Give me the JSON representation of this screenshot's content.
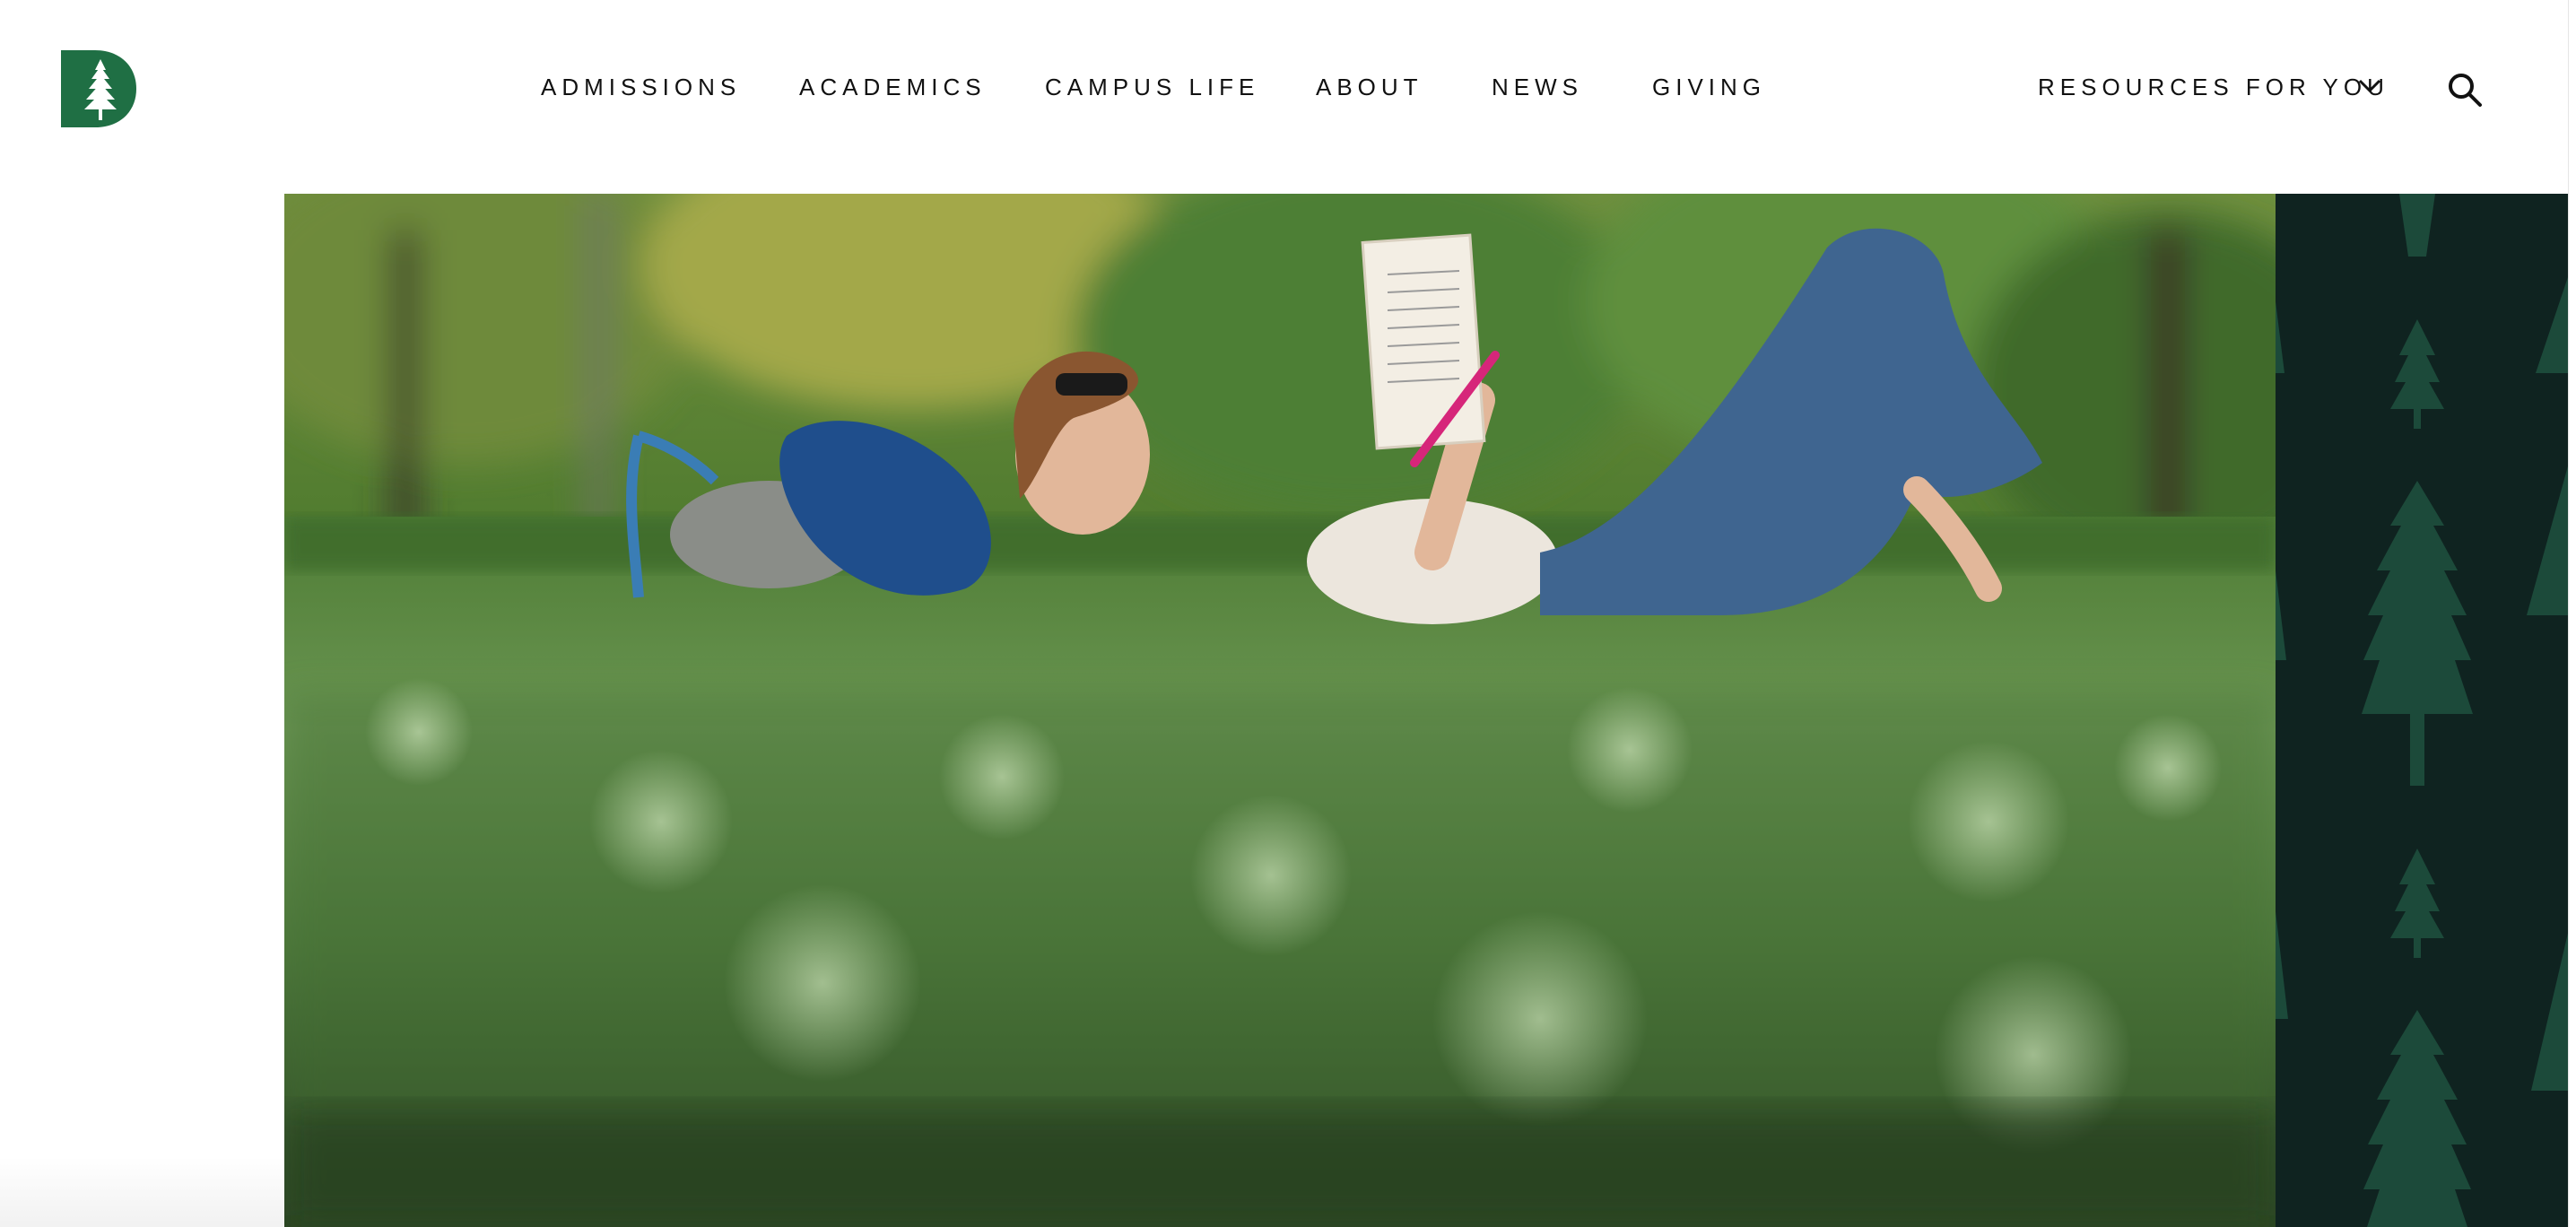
{
  "header": {
    "logo_icon": "dartmouth-d-pine-icon",
    "brand_color": "#1f6f44",
    "nav": [
      {
        "label": "ADMISSIONS"
      },
      {
        "label": "ACADEMICS"
      },
      {
        "label": "CAMPUS LIFE"
      },
      {
        "label": "ABOUT"
      },
      {
        "label": "NEWS"
      },
      {
        "label": "GIVING"
      }
    ],
    "resources_label": "RESOURCES FOR YOU",
    "resources_icon": "chevron-down-icon",
    "search_icon": "search-icon"
  },
  "hero": {
    "image": "student-reading-on-grass",
    "panel_color": "#0f2320",
    "panel_pattern_icon": "pine-tree-icon"
  }
}
